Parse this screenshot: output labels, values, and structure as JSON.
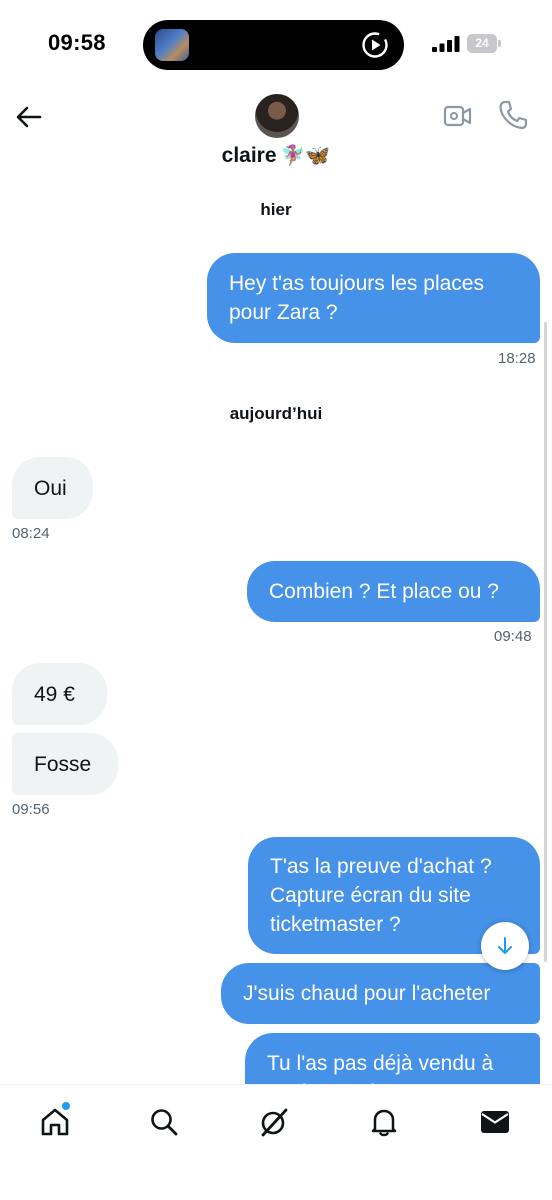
{
  "status_bar": {
    "time": "09:58",
    "battery": "24"
  },
  "header": {
    "contact_name": "claire",
    "name_emojis": "🧚🏽‍♀️🦋"
  },
  "conversation": {
    "date_yesterday": "hier",
    "date_today": "aujourd’hui",
    "messages": [
      {
        "direction": "out",
        "text": "Hey t'as toujours les places\npour Zara ?",
        "time": "18:28"
      },
      {
        "direction": "in",
        "text": "Oui",
        "time": "08:24"
      },
      {
        "direction": "out",
        "text": "Combien ? Et place ou ?",
        "time": "09:48"
      },
      {
        "direction": "in",
        "text": "49 €",
        "time": ""
      },
      {
        "direction": "in",
        "text": "Fosse",
        "time": "09:56"
      },
      {
        "direction": "out",
        "text": "T'as la preuve d'achat ?\nCapture écran du site\nticketmaster ?",
        "time": ""
      },
      {
        "direction": "out",
        "text": "J'suis chaud pour l'acheter",
        "time": ""
      },
      {
        "direction": "out",
        "text": "Tu l'as pas déjà vendu à\nquelqu'un d'autre ?",
        "time": ""
      }
    ]
  },
  "colors": {
    "outgoing_bubble": "#4592e8",
    "incoming_bubble": "#eff3f4",
    "accent": "#1d9bf0"
  },
  "icons": {
    "back": "back-arrow-icon",
    "video": "video-camera-icon",
    "call": "phone-icon",
    "scroll_down": "arrow-down-icon",
    "nav": [
      "home-icon",
      "search-icon",
      "grok-icon",
      "bell-icon",
      "envelope-icon"
    ]
  }
}
